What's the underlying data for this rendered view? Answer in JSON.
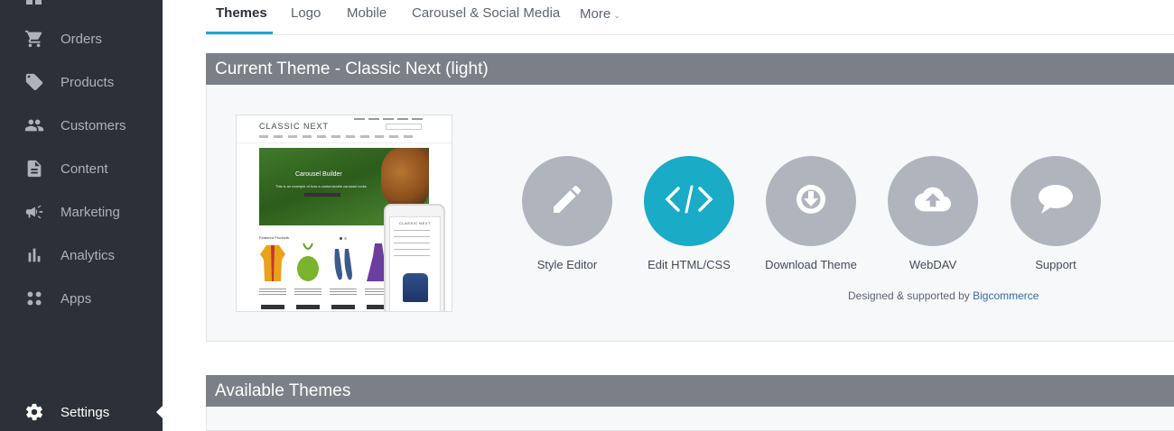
{
  "sidebar": {
    "items": [
      {
        "label": "Orders",
        "icon": "cart-icon"
      },
      {
        "label": "Products",
        "icon": "tag-icon"
      },
      {
        "label": "Customers",
        "icon": "people-icon"
      },
      {
        "label": "Content",
        "icon": "document-icon"
      },
      {
        "label": "Marketing",
        "icon": "megaphone-icon"
      },
      {
        "label": "Analytics",
        "icon": "bar-chart-icon"
      },
      {
        "label": "Apps",
        "icon": "apps-grid-icon"
      },
      {
        "label": "Settings",
        "icon": "gear-icon",
        "active": true
      }
    ]
  },
  "tabs": [
    {
      "label": "Themes",
      "active": true
    },
    {
      "label": "Logo"
    },
    {
      "label": "Mobile"
    },
    {
      "label": "Carousel & Social Media"
    },
    {
      "label": "More"
    }
  ],
  "current_theme": {
    "heading": "Current Theme - Classic Next (light)",
    "preview": {
      "title": "CLASSIC NEXT",
      "carousel_caption": "Carousel Builder",
      "carousel_subtext": "This is an example of how a customizable carousel looks",
      "featured": "Featured Products",
      "phone_title": "CLASSIC NEXT"
    },
    "actions": [
      {
        "label": "Style Editor",
        "icon": "pencil-icon"
      },
      {
        "label": "Edit HTML/CSS",
        "icon": "code-icon",
        "highlighted": true
      },
      {
        "label": "Download Theme",
        "icon": "download-icon"
      },
      {
        "label": "WebDAV",
        "icon": "cloud-upload-icon"
      },
      {
        "label": "Support",
        "icon": "speech-bubble-icon"
      }
    ],
    "credit_text": "Designed & supported by",
    "credit_link": "Bigcommerce"
  },
  "available_themes": {
    "heading": "Available Themes"
  },
  "colors": {
    "sidebar_bg": "#2c3038",
    "accent": "#1aabc6",
    "panel_header": "#7b8088",
    "circle_gray": "#b0b5bd"
  }
}
